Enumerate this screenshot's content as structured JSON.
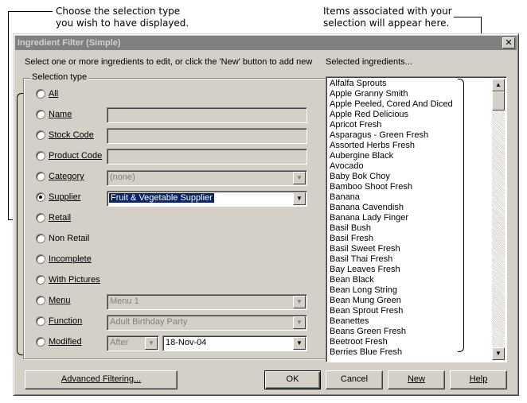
{
  "callouts": {
    "left_line1": "Choose the selection type",
    "left_line2": "you wish to have displayed.",
    "right_line1": "Items associated with your",
    "right_line2": "selection will appear here."
  },
  "dialog": {
    "title": "Ingredient Filter (Simple)",
    "close_glyph": "✕",
    "instruction": "Select one or more ingredients to edit, or click the 'New' button to add new",
    "selected_label": "Selected ingredients...",
    "group_label": "Selection type"
  },
  "selection_types": [
    {
      "label": "All",
      "checked": false
    },
    {
      "label": "Name",
      "checked": false
    },
    {
      "label": "Stock Code",
      "checked": false
    },
    {
      "label": "Product Code",
      "checked": false
    },
    {
      "label": "Category",
      "checked": false
    },
    {
      "label": "Supplier",
      "checked": true
    },
    {
      "label": "Retail",
      "checked": false
    },
    {
      "label": "Non Retail",
      "checked": false
    },
    {
      "label": "Incomplete",
      "checked": false
    },
    {
      "label": "With Pictures",
      "checked": false
    },
    {
      "label": "Menu",
      "checked": false
    },
    {
      "label": "Function",
      "checked": false
    },
    {
      "label": "Modified",
      "checked": false
    }
  ],
  "fields": {
    "name_value": "",
    "stock_code_value": "",
    "product_code_value": "",
    "category_value": "(none)",
    "supplier_value": "Fruit & Vegetable Supplier",
    "menu_value": "Menu 1",
    "function_value": "Adult Birthday Party",
    "modified_op": "After",
    "modified_date": "18-Nov-04"
  },
  "ingredients": [
    "Alfalfa Sprouts",
    "Apple Granny Smith",
    "Apple Peeled, Cored And Diced",
    "Apple Red Delicious",
    "Apricot Fresh",
    "Asparagus - Green Fresh",
    "Assorted Herbs Fresh",
    "Aubergine Black",
    "Avocado",
    "Baby Bok Choy",
    "Bamboo Shoot Fresh",
    "Banana",
    "Banana Cavendish",
    "Banana Lady Finger",
    "Basil Bush",
    "Basil Fresh",
    "Basil Sweet Fresh",
    "Basil Thai Fresh",
    "Bay Leaves Fresh",
    "Bean Black",
    "Bean Long String",
    "Bean Mung Green",
    "Bean Sprout Fresh",
    "Beanettes",
    "Beans Green Fresh",
    "Beetroot Fresh",
    "Berries Blue Fresh"
  ],
  "buttons": {
    "advanced": "Advanced Filtering...",
    "ok": "OK",
    "cancel": "Cancel",
    "new": "New",
    "help": "Help"
  }
}
